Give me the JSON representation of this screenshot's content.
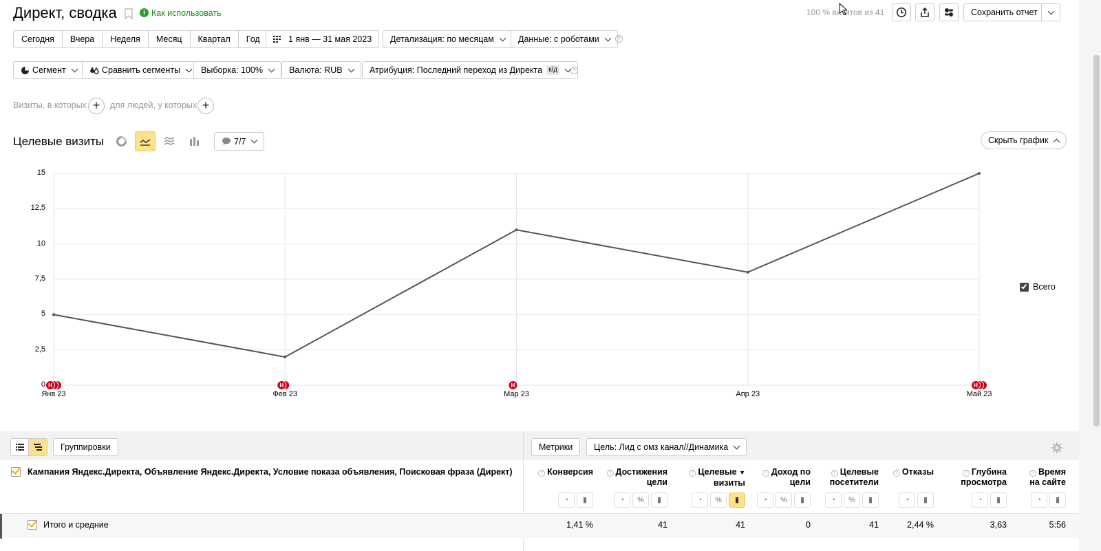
{
  "header": {
    "title": "Директ, сводка",
    "how_to_use": "Как использовать",
    "sample_info": "100 % визитов из 41",
    "save_report": "Сохранить отчет"
  },
  "periods": [
    "Сегодня",
    "Вчера",
    "Неделя",
    "Месяц",
    "Квартал",
    "Год"
  ],
  "date_range": "1 янв — 31 мая 2023",
  "detail": "Детализация: по месяцам",
  "data_mode": "Данные: с роботами",
  "filters": {
    "segment": "Сегмент",
    "compare": "Сравнить сегменты",
    "sample": "Выборка: 100%",
    "currency": "Валюта: RUB",
    "attribution": "Атрибуция: Последний переход из Директа",
    "attribution_badge": "к/д"
  },
  "conditions": {
    "visits": "Визиты, в которых",
    "people": "для людей, у которых"
  },
  "chart_header": {
    "title": "Целевые визиты",
    "annotations": "7/7",
    "hide_chart": "Скрыть график"
  },
  "legend": {
    "total": "Всего"
  },
  "chart_data": {
    "type": "line",
    "categories": [
      "Янв 23",
      "Фев 23",
      "Мар 23",
      "Апр 23",
      "Май 23"
    ],
    "series": [
      {
        "name": "Всего",
        "values": [
          5,
          2,
          11,
          8,
          15
        ]
      }
    ],
    "yticks": [
      "0",
      "2,5",
      "5",
      "7,5",
      "10",
      "12,5",
      "15"
    ],
    "ylim": [
      0,
      15
    ],
    "grid": true,
    "legend_position": "right",
    "line_color": "#555555",
    "marker_letter": "Н",
    "marker_color": "#d0021b"
  },
  "table": {
    "groupings_btn": "Группировки",
    "metrics_btn": "Метрики",
    "goal_select": "Цель: Лид с омз канал//Динамика",
    "dimensions_header": "Кампания Яндекс.Директа, Объявление Яндекс.Директа, Условие показа объявления, Поисковая фраза (Директ)",
    "columns": [
      {
        "line1": "Конверсия",
        "line2": ""
      },
      {
        "line1": "Достижения",
        "line2": "цели"
      },
      {
        "line1": "Целевые",
        "line2": "визиты"
      },
      {
        "line1": "Доход по",
        "line2": "цели"
      },
      {
        "line1": "Целевые",
        "line2": "посетители"
      },
      {
        "line1": "Отказы",
        "line2": ""
      },
      {
        "line1": "Глубина",
        "line2": "просмотра"
      },
      {
        "line1": "Время",
        "line2": "на сайте"
      }
    ],
    "totals_label": "Итого и средние",
    "totals": [
      "1,41 %",
      "41",
      "41",
      "0",
      "41",
      "2,44 %",
      "3,63",
      "5:56"
    ]
  }
}
